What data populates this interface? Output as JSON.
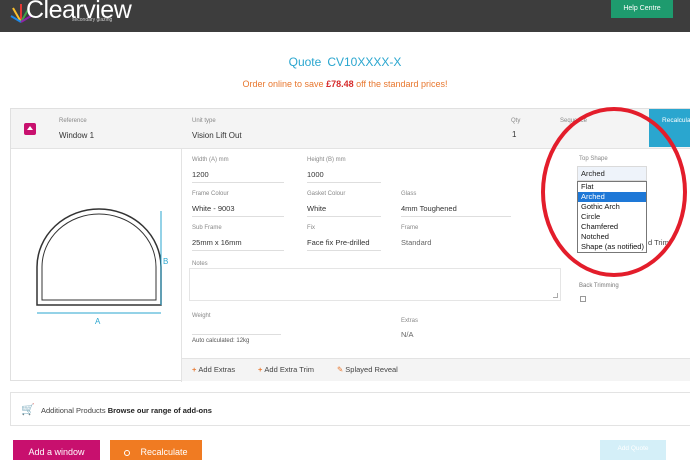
{
  "header": {
    "logo_text": "Clearview",
    "logo_sub": "secondary glazing",
    "help_label": "Help Centre"
  },
  "quote": {
    "title": "Quote",
    "ref": "CV10XXXX-X",
    "promo_before": "Order online to save ",
    "promo_amount": "£78.48",
    "promo_after": " off the standard prices!"
  },
  "window": {
    "reference_label": "Reference",
    "reference_value": "Window 1",
    "unit_type_label": "Unit type",
    "unit_type_value": "Vision Lift Out",
    "qty_label": "Qty",
    "qty_value": "1",
    "sequence_label": "Sequence",
    "recalc_label": "Recalculate",
    "diagram_label_a": "A",
    "diagram_label_b": "B"
  },
  "form": {
    "width_label": "Width (A) mm",
    "width_value": "1200",
    "height_label": "Height (B) mm",
    "height_value": "1000",
    "frame_colour_label": "Frame Colour",
    "frame_colour_value": "White - 9003",
    "gasket_colour_label": "Gasket Colour",
    "gasket_colour_value": "White",
    "glass_label": "Glass",
    "glass_value": "4mm Toughened",
    "sub_frame_label": "Sub Frame",
    "sub_frame_value": "25mm x 16mm",
    "fix_label": "Fix",
    "fix_value": "Face fix Pre-drilled",
    "frame_label": "Frame",
    "frame_value": "Standard",
    "notes_label": "Notes",
    "weight_label": "Weight",
    "weight_note": "Auto calculated: 12kg",
    "extras_label": "Extras",
    "extras_value": "N/A",
    "top_shape_label": "Top Shape",
    "top_shape_selected": "Arched",
    "top_shape_options": [
      "Flat",
      "Arched",
      "Gothic Arch",
      "Circle",
      "Chamfered",
      "Notched",
      "Shape (as notified)"
    ],
    "partial_trim_label": "d Trim",
    "back_trimming_label": "Back Trimming"
  },
  "footer": {
    "add_extras": "Add Extras",
    "add_extra_trim": "Add Extra Trim",
    "splayed_reveal": "Splayed Reveal"
  },
  "addons": {
    "prefix": "Additional Products",
    "link": "Browse our range of add-ons"
  },
  "actions": {
    "add_window": "Add a window",
    "recalculate": "Recalculate",
    "faded_btn": "Add Quote"
  },
  "colors": {
    "accent_blue": "#2aa6cf",
    "accent_pink": "#c8106e",
    "accent_orange": "#f07b22",
    "help_green": "#1e9b6e",
    "highlight_red": "#e31d2b"
  }
}
